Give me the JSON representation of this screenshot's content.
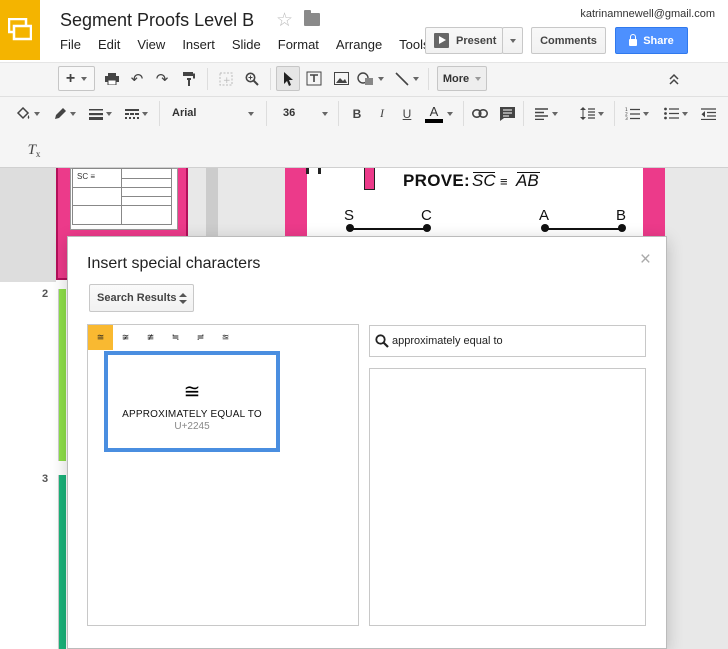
{
  "header": {
    "doc_title": "Segment Proofs Level B",
    "user_email": "katrinamnewell@gmail.com",
    "menu": [
      "File",
      "Edit",
      "View",
      "Insert",
      "Slide",
      "Format",
      "Arrange",
      "Tools"
    ],
    "present_label": "Present",
    "comments_label": "Comments",
    "share_label": "Share",
    "brand_color": "#f4b400",
    "share_color": "#4d90fe"
  },
  "toolbar": {
    "more_label": "More",
    "font_name": "Arial",
    "font_size": "36"
  },
  "filmstrip": {
    "slide_numbers": [
      "2",
      "3"
    ],
    "thumb_label": "SC ≡"
  },
  "slide": {
    "prove_label": "PROVE:",
    "seg1": "SC",
    "congruent": "≡",
    "seg2": "AB",
    "points": [
      "S",
      "C",
      "A",
      "B"
    ]
  },
  "dialog": {
    "title": "Insert special characters",
    "category": "Search Results",
    "close_glyph": "×",
    "results": [
      "≅",
      "≆",
      "≇",
      "≒",
      "≓",
      "≊"
    ],
    "selected": {
      "glyph": "≅",
      "name": "APPROXIMATELY EQUAL TO",
      "code": "U+2245"
    },
    "search_value": "approximately equal to",
    "accent_color": "#f9b931",
    "preview_border_color": "#4a8ee0"
  }
}
